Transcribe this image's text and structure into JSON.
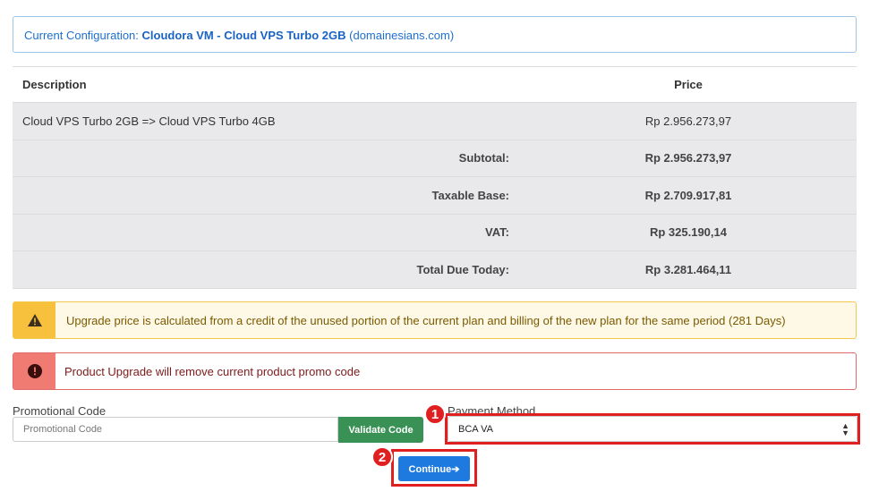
{
  "config": {
    "prefix": "Current Configuration:",
    "product": "Cloudora VM - Cloud VPS Turbo 2GB",
    "domain": "(domainesians.com)"
  },
  "table": {
    "headers": {
      "description": "Description",
      "price": "Price"
    },
    "line_item": {
      "description": "Cloud VPS Turbo 2GB => Cloud VPS Turbo 4GB",
      "price": "Rp 2.956.273,97"
    },
    "summary": [
      {
        "label": "Subtotal:",
        "value": "Rp 2.956.273,97"
      },
      {
        "label": "Taxable Base:",
        "value": "Rp 2.709.917,81"
      },
      {
        "label": "VAT:",
        "value": "Rp 325.190,14"
      },
      {
        "label": "Total Due Today:",
        "value": "Rp 3.281.464,11"
      }
    ]
  },
  "alerts": {
    "warning": "Upgrade price is calculated from a credit of the unused portion of the current plan and billing of the new plan for the same period (281 Days)",
    "danger": "Product Upgrade will remove current product promo code"
  },
  "promo": {
    "label": "Promotional Code",
    "placeholder": "Promotional Code",
    "validate_label": "Validate Code"
  },
  "payment": {
    "label": "Payment Method",
    "selected": "BCA VA"
  },
  "continue_label": "Continue",
  "badges": {
    "one": "1",
    "two": "2"
  },
  "colors": {
    "accent": "#1f7ae0",
    "success": "#3a9155",
    "highlight": "#e02020"
  }
}
